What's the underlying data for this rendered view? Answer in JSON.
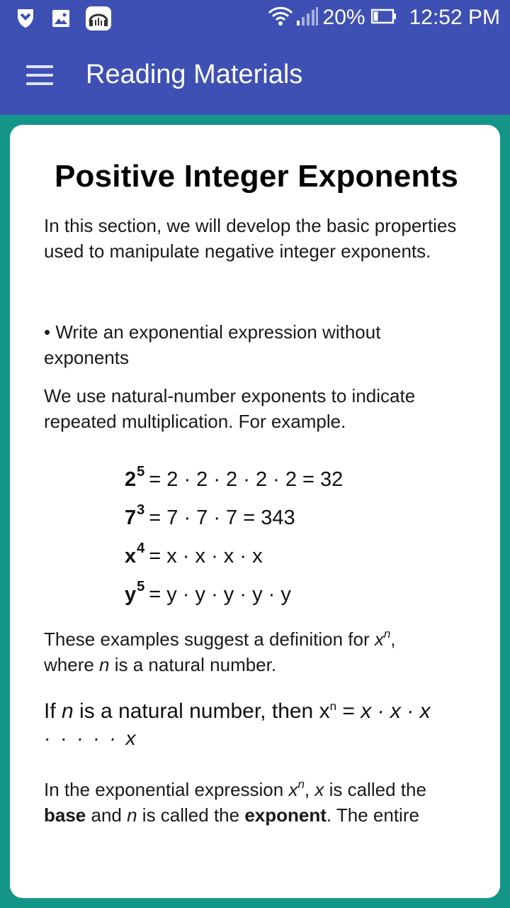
{
  "status_bar": {
    "left_icons": [
      "shield-icon",
      "image-icon",
      "headphones-app-icon"
    ],
    "battery": "20%",
    "time": "12:52 PM"
  },
  "app_bar": {
    "title": "Reading Materials"
  },
  "article": {
    "title": "Positive Integer Exponents",
    "intro": "In this section, we will develop the basic properties used to manipulate negative integer exponents.",
    "bullet": "• Write an exponential expression without exponents",
    "lead": "We use natural-number exponents to indicate repeated multiplication. For example.",
    "examples": [
      {
        "base": "2",
        "exp": "5",
        "expansion": "= 2 · 2 · 2 · 2 · 2 = 32"
      },
      {
        "base": "7",
        "exp": "3",
        "expansion": "= 7 · 7 · 7 = 343"
      },
      {
        "base": "x",
        "exp": "4",
        "expansion": "= x · x · x · x"
      },
      {
        "base": "y",
        "exp": "5",
        "expansion": "= y · y · y · y · y"
      }
    ],
    "suggest_1": "These examples suggest a definition for ",
    "suggest_var": "x",
    "suggest_exp": "n",
    "suggest_2": ",",
    "suggest_3": "where ",
    "suggest_n": "n",
    "suggest_4": " is a natural number.",
    "def_1": "If ",
    "def_n": "n",
    "def_2": " is a natural number, then x",
    "def_exp": "n",
    "def_3": " = ",
    "def_4": "x · x · x",
    "def_5": "· · · · · x",
    "expr_1": "In the exponential expression ",
    "expr_var": "x",
    "expr_exp": "n",
    "expr_2": ", ",
    "expr_x": "x",
    "expr_3": " is called the",
    "expr_base": "base",
    "expr_4": " and ",
    "expr_n": "n",
    "expr_5": " is called the ",
    "expr_exponent": "exponent",
    "expr_6": ". The entire"
  }
}
